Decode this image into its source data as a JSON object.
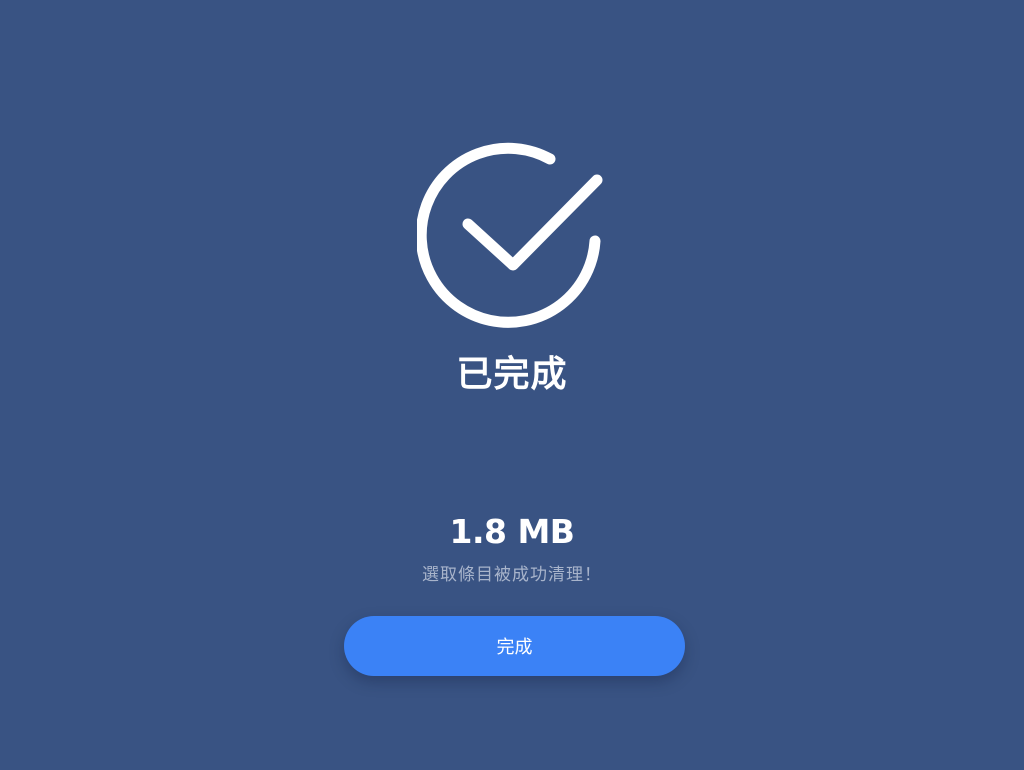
{
  "result": {
    "title": "已完成",
    "size": "1.8 MB",
    "message": "選取條目被成功清理！"
  },
  "actions": {
    "done_label": "完成"
  },
  "icons": {
    "status": "checkmark-circle-icon"
  },
  "colors": {
    "background": "#395383",
    "button": "#3b82f6",
    "text": "#ffffff",
    "muted_text": "#a8b4cb"
  }
}
